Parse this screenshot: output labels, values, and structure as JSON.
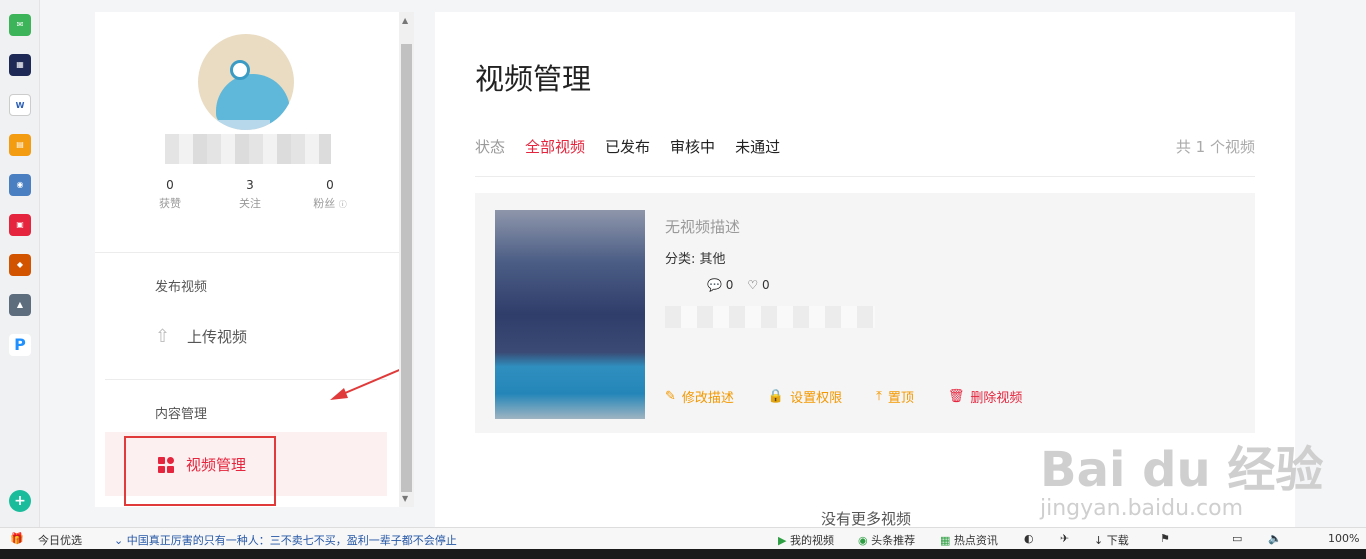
{
  "profile": {
    "stats": [
      {
        "num": "0",
        "label": "获赞"
      },
      {
        "num": "3",
        "label": "关注"
      },
      {
        "num": "0",
        "label": "粉丝"
      }
    ]
  },
  "nav": {
    "publish_section": "发布视频",
    "upload_label": "上传视频",
    "content_section": "内容管理",
    "video_manage_label": "视频管理"
  },
  "main": {
    "title": "视频管理",
    "status_label": "状态",
    "tabs": [
      "全部视频",
      "已发布",
      "审核中",
      "未通过"
    ],
    "video_count": "共 1 个视频",
    "video": {
      "description": "无视频描述",
      "category": "分类: 其他",
      "comments": "0",
      "likes": "0",
      "actions": [
        "修改描述",
        "设置权限",
        "置顶",
        "删除视频"
      ]
    },
    "no_more": "没有更多视频"
  },
  "watermark": {
    "brand": "Bai du 经验",
    "site": "jingyan.baidu.com"
  },
  "status_bar": {
    "today": "今日优选",
    "headline": "中国真正厉害的只有一种人：三不卖七不买，盈利一辈子都不会停止",
    "my_video": "我的视频",
    "headline_rec": "头条推荐",
    "hot_news": "热点资讯",
    "download": "下载",
    "zoom": "100%"
  },
  "colors": {
    "accent": "#e4253d",
    "action_orange": "#f39800"
  }
}
